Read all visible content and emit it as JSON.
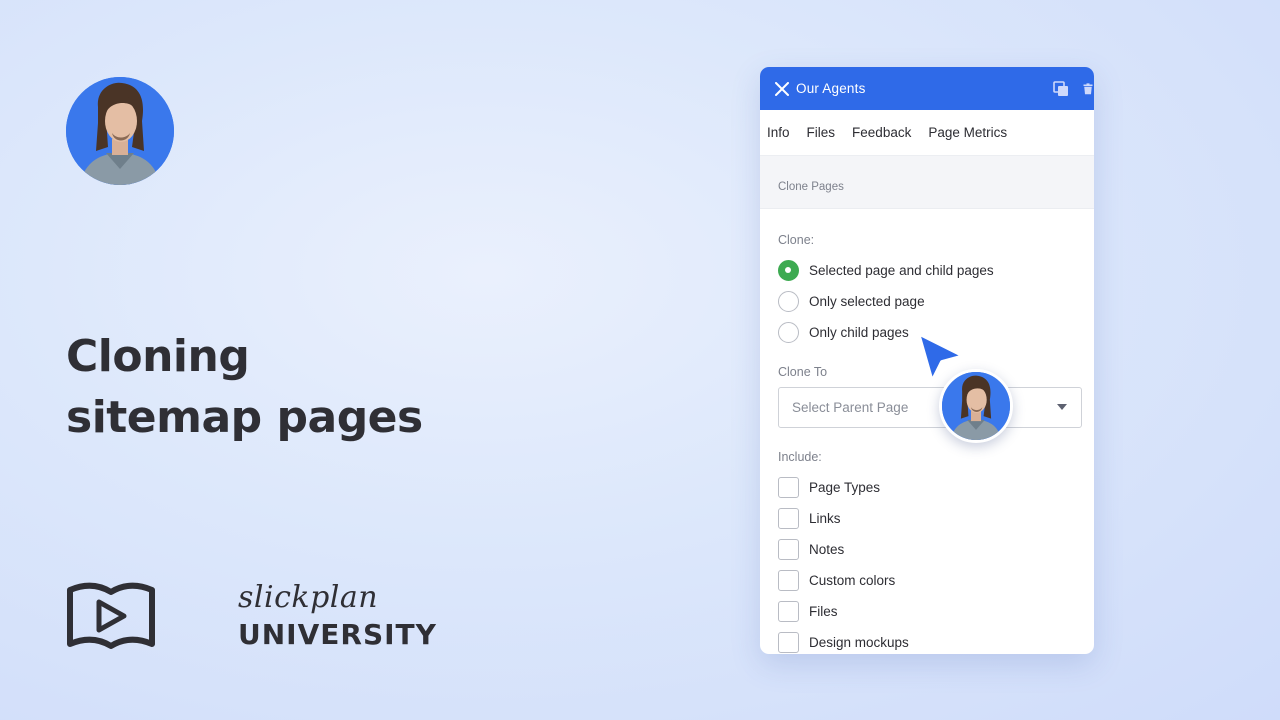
{
  "headline": {
    "line1": "Cloning",
    "line2": "sitemap pages"
  },
  "logo": {
    "script": "slickplan",
    "university": "UNIVERSITY"
  },
  "panel": {
    "title": "Our Agents",
    "tabs": [
      "Info",
      "Files",
      "Feedback",
      "Page Metrics"
    ],
    "section_title": "Clone Pages",
    "clone_label": "Clone:",
    "clone_options": [
      {
        "label": "Selected page and child pages",
        "checked": true
      },
      {
        "label": "Only selected page",
        "checked": false
      },
      {
        "label": "Only child pages",
        "checked": false
      }
    ],
    "clone_to_label": "Clone To",
    "select_placeholder": "Select Parent Page",
    "include_label": "Include:",
    "include_options": [
      {
        "label": "Page Types",
        "checked": false
      },
      {
        "label": "Links",
        "checked": false
      },
      {
        "label": "Notes",
        "checked": false
      },
      {
        "label": "Custom colors",
        "checked": false
      },
      {
        "label": "Files",
        "checked": false
      },
      {
        "label": "Design mockups",
        "checked": false
      }
    ]
  },
  "colors": {
    "header_blue": "#2f6ae8",
    "radio_checked_green": "#3daa51",
    "avatar_blue": "#3a78ec",
    "cursor_blue": "#2f6ae8"
  },
  "icons": {
    "header_close": "close-icon",
    "header_duplicate": "duplicate-icon",
    "header_delete": "trash-icon",
    "cursor": "pointer-arrow-icon",
    "logo": "book-play-icon"
  }
}
